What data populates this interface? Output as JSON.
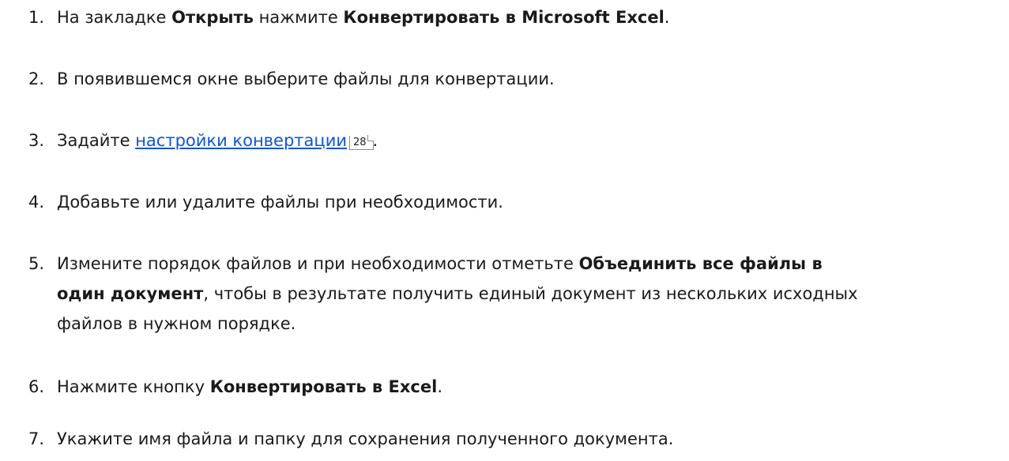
{
  "steps": [
    {
      "num": "1.",
      "pre": "На закладке ",
      "bold1": "Открыть",
      "mid": " нажмите ",
      "bold2": "Конвертировать в Microsoft Excel",
      "post": "."
    },
    {
      "num": "2.",
      "text": "В появившемся окне выберите файлы для конвертации."
    },
    {
      "num": "3.",
      "pre": "Задайте ",
      "link": "настройки конвертации",
      "page_ref": "28",
      "post": "."
    },
    {
      "num": "4.",
      "text": "Добавьте или удалите файлы при необходимости."
    },
    {
      "num": "5.",
      "pre": "Измените порядок файлов и при необходимости отметьте ",
      "bold_line1": "Объединить все файлы в",
      "bold_line2": "один документ",
      "line2_rest": ", чтобы в результате получить единый документ из нескольких исходных",
      "line3": "файлов в нужном порядке."
    },
    {
      "num": "6.",
      "pre": "Нажмите кнопку ",
      "bold": "Конвертировать в Excel",
      "post": "."
    },
    {
      "num": "7.",
      "text": "Укажите имя файла и папку для сохранения полученного документа."
    }
  ]
}
